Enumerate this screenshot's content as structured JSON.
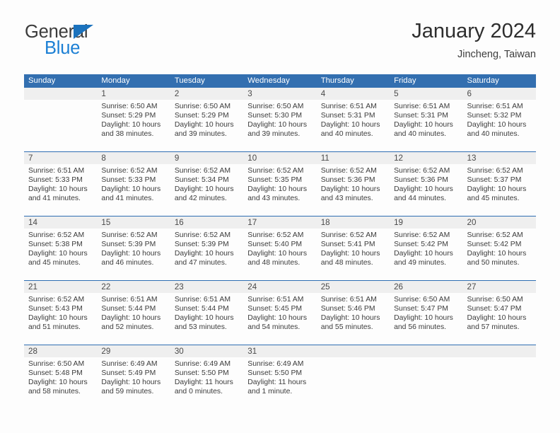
{
  "brand": {
    "name_part1": "General",
    "name_part2": "Blue",
    "accent_color": "#1b7fd4",
    "triangle_color": "#1b72bd"
  },
  "header": {
    "title": "January 2024",
    "subtitle": "Jincheng, Taiwan"
  },
  "theme": {
    "header_row_color": "#336fb0",
    "row_divider_color": "#2f6eb3",
    "day_band_color": "#efefef",
    "page_background": "#fdfdfd"
  },
  "weekdays": [
    "Sunday",
    "Monday",
    "Tuesday",
    "Wednesday",
    "Thursday",
    "Friday",
    "Saturday"
  ],
  "weeks": [
    [
      {
        "day": "",
        "sunrise": "",
        "sunset": "",
        "daylight_line1": "",
        "daylight_line2": ""
      },
      {
        "day": "1",
        "sunrise": "Sunrise: 6:50 AM",
        "sunset": "Sunset: 5:29 PM",
        "daylight_line1": "Daylight: 10 hours",
        "daylight_line2": "and 38 minutes."
      },
      {
        "day": "2",
        "sunrise": "Sunrise: 6:50 AM",
        "sunset": "Sunset: 5:29 PM",
        "daylight_line1": "Daylight: 10 hours",
        "daylight_line2": "and 39 minutes."
      },
      {
        "day": "3",
        "sunrise": "Sunrise: 6:50 AM",
        "sunset": "Sunset: 5:30 PM",
        "daylight_line1": "Daylight: 10 hours",
        "daylight_line2": "and 39 minutes."
      },
      {
        "day": "4",
        "sunrise": "Sunrise: 6:51 AM",
        "sunset": "Sunset: 5:31 PM",
        "daylight_line1": "Daylight: 10 hours",
        "daylight_line2": "and 40 minutes."
      },
      {
        "day": "5",
        "sunrise": "Sunrise: 6:51 AM",
        "sunset": "Sunset: 5:31 PM",
        "daylight_line1": "Daylight: 10 hours",
        "daylight_line2": "and 40 minutes."
      },
      {
        "day": "6",
        "sunrise": "Sunrise: 6:51 AM",
        "sunset": "Sunset: 5:32 PM",
        "daylight_line1": "Daylight: 10 hours",
        "daylight_line2": "and 40 minutes."
      }
    ],
    [
      {
        "day": "7",
        "sunrise": "Sunrise: 6:51 AM",
        "sunset": "Sunset: 5:33 PM",
        "daylight_line1": "Daylight: 10 hours",
        "daylight_line2": "and 41 minutes."
      },
      {
        "day": "8",
        "sunrise": "Sunrise: 6:52 AM",
        "sunset": "Sunset: 5:33 PM",
        "daylight_line1": "Daylight: 10 hours",
        "daylight_line2": "and 41 minutes."
      },
      {
        "day": "9",
        "sunrise": "Sunrise: 6:52 AM",
        "sunset": "Sunset: 5:34 PM",
        "daylight_line1": "Daylight: 10 hours",
        "daylight_line2": "and 42 minutes."
      },
      {
        "day": "10",
        "sunrise": "Sunrise: 6:52 AM",
        "sunset": "Sunset: 5:35 PM",
        "daylight_line1": "Daylight: 10 hours",
        "daylight_line2": "and 43 minutes."
      },
      {
        "day": "11",
        "sunrise": "Sunrise: 6:52 AM",
        "sunset": "Sunset: 5:36 PM",
        "daylight_line1": "Daylight: 10 hours",
        "daylight_line2": "and 43 minutes."
      },
      {
        "day": "12",
        "sunrise": "Sunrise: 6:52 AM",
        "sunset": "Sunset: 5:36 PM",
        "daylight_line1": "Daylight: 10 hours",
        "daylight_line2": "and 44 minutes."
      },
      {
        "day": "13",
        "sunrise": "Sunrise: 6:52 AM",
        "sunset": "Sunset: 5:37 PM",
        "daylight_line1": "Daylight: 10 hours",
        "daylight_line2": "and 45 minutes."
      }
    ],
    [
      {
        "day": "14",
        "sunrise": "Sunrise: 6:52 AM",
        "sunset": "Sunset: 5:38 PM",
        "daylight_line1": "Daylight: 10 hours",
        "daylight_line2": "and 45 minutes."
      },
      {
        "day": "15",
        "sunrise": "Sunrise: 6:52 AM",
        "sunset": "Sunset: 5:39 PM",
        "daylight_line1": "Daylight: 10 hours",
        "daylight_line2": "and 46 minutes."
      },
      {
        "day": "16",
        "sunrise": "Sunrise: 6:52 AM",
        "sunset": "Sunset: 5:39 PM",
        "daylight_line1": "Daylight: 10 hours",
        "daylight_line2": "and 47 minutes."
      },
      {
        "day": "17",
        "sunrise": "Sunrise: 6:52 AM",
        "sunset": "Sunset: 5:40 PM",
        "daylight_line1": "Daylight: 10 hours",
        "daylight_line2": "and 48 minutes."
      },
      {
        "day": "18",
        "sunrise": "Sunrise: 6:52 AM",
        "sunset": "Sunset: 5:41 PM",
        "daylight_line1": "Daylight: 10 hours",
        "daylight_line2": "and 48 minutes."
      },
      {
        "day": "19",
        "sunrise": "Sunrise: 6:52 AM",
        "sunset": "Sunset: 5:42 PM",
        "daylight_line1": "Daylight: 10 hours",
        "daylight_line2": "and 49 minutes."
      },
      {
        "day": "20",
        "sunrise": "Sunrise: 6:52 AM",
        "sunset": "Sunset: 5:42 PM",
        "daylight_line1": "Daylight: 10 hours",
        "daylight_line2": "and 50 minutes."
      }
    ],
    [
      {
        "day": "21",
        "sunrise": "Sunrise: 6:52 AM",
        "sunset": "Sunset: 5:43 PM",
        "daylight_line1": "Daylight: 10 hours",
        "daylight_line2": "and 51 minutes."
      },
      {
        "day": "22",
        "sunrise": "Sunrise: 6:51 AM",
        "sunset": "Sunset: 5:44 PM",
        "daylight_line1": "Daylight: 10 hours",
        "daylight_line2": "and 52 minutes."
      },
      {
        "day": "23",
        "sunrise": "Sunrise: 6:51 AM",
        "sunset": "Sunset: 5:44 PM",
        "daylight_line1": "Daylight: 10 hours",
        "daylight_line2": "and 53 minutes."
      },
      {
        "day": "24",
        "sunrise": "Sunrise: 6:51 AM",
        "sunset": "Sunset: 5:45 PM",
        "daylight_line1": "Daylight: 10 hours",
        "daylight_line2": "and 54 minutes."
      },
      {
        "day": "25",
        "sunrise": "Sunrise: 6:51 AM",
        "sunset": "Sunset: 5:46 PM",
        "daylight_line1": "Daylight: 10 hours",
        "daylight_line2": "and 55 minutes."
      },
      {
        "day": "26",
        "sunrise": "Sunrise: 6:50 AM",
        "sunset": "Sunset: 5:47 PM",
        "daylight_line1": "Daylight: 10 hours",
        "daylight_line2": "and 56 minutes."
      },
      {
        "day": "27",
        "sunrise": "Sunrise: 6:50 AM",
        "sunset": "Sunset: 5:47 PM",
        "daylight_line1": "Daylight: 10 hours",
        "daylight_line2": "and 57 minutes."
      }
    ],
    [
      {
        "day": "28",
        "sunrise": "Sunrise: 6:50 AM",
        "sunset": "Sunset: 5:48 PM",
        "daylight_line1": "Daylight: 10 hours",
        "daylight_line2": "and 58 minutes."
      },
      {
        "day": "29",
        "sunrise": "Sunrise: 6:49 AM",
        "sunset": "Sunset: 5:49 PM",
        "daylight_line1": "Daylight: 10 hours",
        "daylight_line2": "and 59 minutes."
      },
      {
        "day": "30",
        "sunrise": "Sunrise: 6:49 AM",
        "sunset": "Sunset: 5:50 PM",
        "daylight_line1": "Daylight: 11 hours",
        "daylight_line2": "and 0 minutes."
      },
      {
        "day": "31",
        "sunrise": "Sunrise: 6:49 AM",
        "sunset": "Sunset: 5:50 PM",
        "daylight_line1": "Daylight: 11 hours",
        "daylight_line2": "and 1 minute."
      },
      {
        "day": "",
        "sunrise": "",
        "sunset": "",
        "daylight_line1": "",
        "daylight_line2": ""
      },
      {
        "day": "",
        "sunrise": "",
        "sunset": "",
        "daylight_line1": "",
        "daylight_line2": ""
      },
      {
        "day": "",
        "sunrise": "",
        "sunset": "",
        "daylight_line1": "",
        "daylight_line2": ""
      }
    ]
  ]
}
